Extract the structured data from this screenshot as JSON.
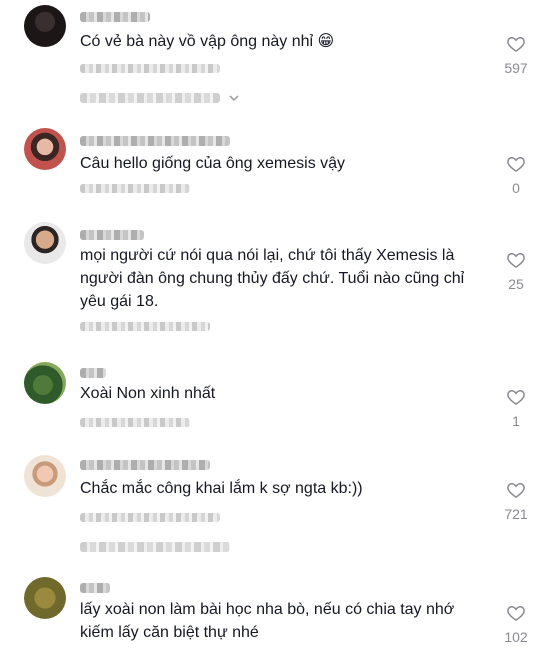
{
  "comments": [
    {
      "text": "Có vẻ bà này vồ vập ông này nhỉ 😁",
      "likes": "597",
      "has_replies": true
    },
    {
      "text": "Câu hello giống của ông xemesis vậy",
      "likes": "0",
      "has_replies": false
    },
    {
      "text": "mọi người cứ nói qua nói lại, chứ tôi thấy Xemesis là người đàn ông chung thủy đấy chứ. Tuổi nào cũng chỉ yêu gái 18.",
      "likes": "25",
      "has_replies": false
    },
    {
      "text": "Xoài Non xinh nhất",
      "likes": "1",
      "has_replies": false
    },
    {
      "text": "Chắc mắc công khai lắm k sợ ngta kb:))",
      "likes": "721",
      "has_replies": true
    },
    {
      "text": "lấy xoài non làm bài học nha bò, nếu có chia tay nhớ kiếm lấy căn biệt thự nhé",
      "likes": "102",
      "has_replies": false
    }
  ],
  "icons": {
    "like": "heart-outline-icon",
    "expand": "chevron-down-icon"
  },
  "colors": {
    "text": "#161823",
    "muted": "#8a8b91",
    "heart_stroke": "#8a8b91"
  }
}
